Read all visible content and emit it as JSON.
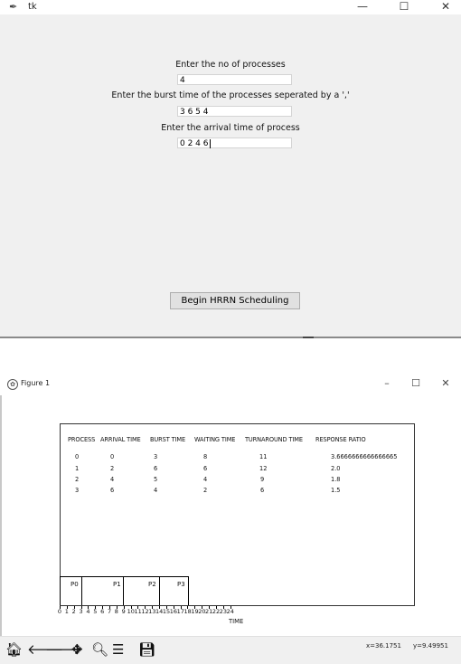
{
  "tk": {
    "title": "tk",
    "prompt_count": "Enter the no of processes",
    "count_value": "4",
    "prompt_burst": "Enter the burst time of the processes seperated by a ','",
    "burst_value": "3 6 5 4",
    "prompt_arrival": "Enter the arrival time of process",
    "arrival_value": "0 2 4 6",
    "button_label": "Begin  HRRN Scheduling",
    "controls": {
      "minimize": "—",
      "maximize": "☐",
      "close": "✕"
    }
  },
  "figure": {
    "title": "Figure 1",
    "controls": {
      "minimize": "–",
      "maximize": "☐",
      "close": "✕"
    },
    "table": {
      "headers": [
        "PROCESS",
        "ARRIVAL TIME",
        "BURST TIME",
        "WAITING TIME",
        "TURNAROUND TIME",
        "RESPONSE RATIO"
      ],
      "rows": [
        [
          "0",
          "0",
          "3",
          "8",
          "11",
          "3.6666666666666665"
        ],
        [
          "1",
          "2",
          "6",
          "6",
          "12",
          "2.0"
        ],
        [
          "2",
          "4",
          "5",
          "4",
          "9",
          "1.8"
        ],
        [
          "3",
          "6",
          "4",
          "2",
          "6",
          "1.5"
        ]
      ]
    },
    "gantt": [
      {
        "label": "P0",
        "start": 0,
        "end": 3
      },
      {
        "label": "P1",
        "start": 3,
        "end": 9
      },
      {
        "label": "P2",
        "start": 9,
        "end": 14
      },
      {
        "label": "P3",
        "start": 14,
        "end": 18
      }
    ],
    "x_ticks": [
      "0",
      "1",
      "2",
      "3",
      "4",
      "5",
      "6",
      "7",
      "8",
      "9",
      "10",
      "11",
      "12",
      "13",
      "14",
      "15",
      "16",
      "17",
      "18",
      "19",
      "20",
      "21",
      "22",
      "23",
      "24"
    ],
    "xlabel": "TIME",
    "coords": {
      "x": "x=36.1751",
      "y": "y=9.49951"
    },
    "toolbar_icons": [
      "home-icon",
      "back-arrow-icon",
      "forward-arrow-icon",
      "pan-icon",
      "zoom-icon",
      "configure-subplots-icon",
      "save-icon"
    ]
  }
}
